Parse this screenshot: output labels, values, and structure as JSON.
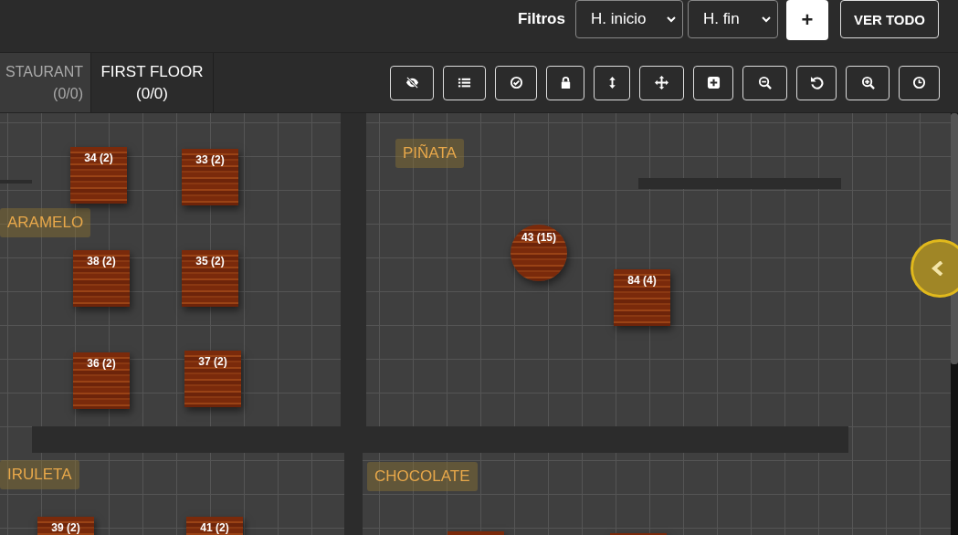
{
  "header": {
    "filter_label": "Filtros",
    "start_select": "H. inicio",
    "end_select": "H. fin",
    "add_button": "+",
    "view_all_button": "VER TODO"
  },
  "floor_tabs": [
    {
      "label": "STAURANT",
      "count": "(0/0)",
      "selected": false
    },
    {
      "label": "FIRST FLOOR",
      "count": "(0/0)",
      "selected": true
    }
  ],
  "zones": [
    "PIÑATA",
    "ARAMELO",
    "IRULETA",
    "CHOCOLATE"
  ],
  "tables": [
    {
      "label": "34 (2)",
      "kind": "square"
    },
    {
      "label": "33 (2)",
      "kind": "square"
    },
    {
      "label": "38 (2)",
      "kind": "square"
    },
    {
      "label": "35 (2)",
      "kind": "square"
    },
    {
      "label": "36 (2)",
      "kind": "square"
    },
    {
      "label": "37 (2)",
      "kind": "square"
    },
    {
      "label": "43 (15)",
      "kind": "round"
    },
    {
      "label": "84 (4)",
      "kind": "square"
    },
    {
      "label": "39 (2)",
      "kind": "square"
    },
    {
      "label": "41 (2)",
      "kind": "square"
    }
  ]
}
